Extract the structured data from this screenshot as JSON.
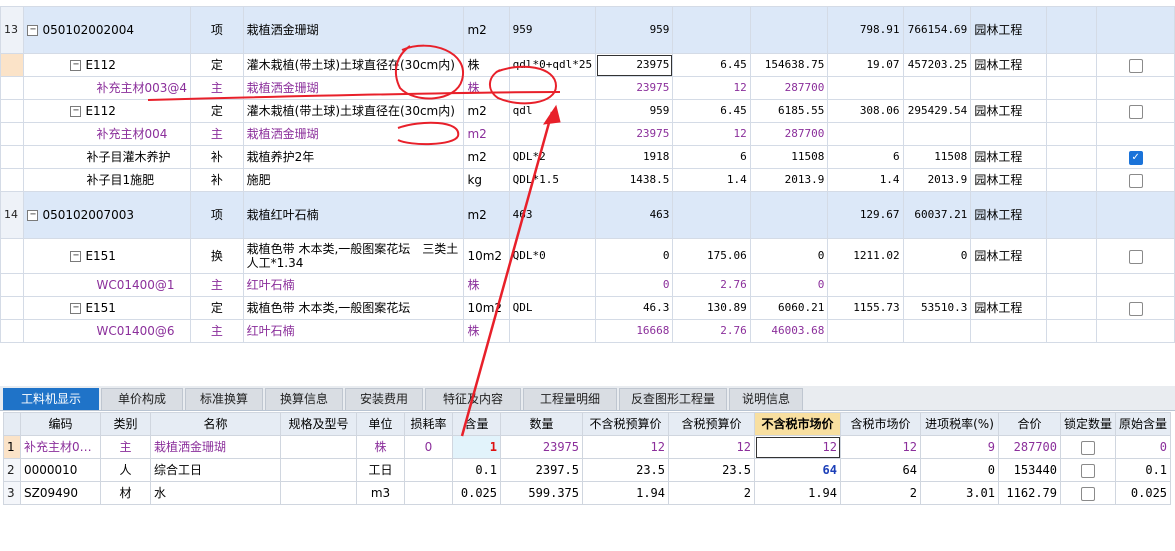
{
  "upper_rows": [
    {
      "rownum": "13",
      "code": "050102002004",
      "type": "项",
      "name": "栽植洒金珊瑚",
      "unit": "m2",
      "expr": "959",
      "qty": "959",
      "price": "",
      "total": "",
      "tax": "798.91",
      "amount": "766154.69",
      "category": "园林工程",
      "checked": null
    },
    {
      "rownum": "",
      "code": "E112",
      "type": "定",
      "name": "灌木栽植(带土球)土球直径在(30cm内)",
      "unit": "株",
      "expr": "qdl*0+qdl*25",
      "qty": "23975",
      "price": "6.45",
      "total": "154638.75",
      "tax": "19.07",
      "amount": "457203.25",
      "category": "园林工程",
      "checked": false
    },
    {
      "rownum": "",
      "code": "补充主材003@4",
      "type": "主",
      "name": "栽植洒金珊瑚",
      "unit": "株",
      "expr": "",
      "qty": "23975",
      "price": "12",
      "total": "287700",
      "tax": "",
      "amount": "",
      "category": "",
      "checked": null
    },
    {
      "rownum": "",
      "code": "E112",
      "type": "定",
      "name": "灌木栽植(带土球)土球直径在(30cm内)",
      "unit": "m2",
      "expr": "qdl",
      "qty": "959",
      "price": "6.45",
      "total": "6185.55",
      "tax": "308.06",
      "amount": "295429.54",
      "category": "园林工程",
      "checked": false
    },
    {
      "rownum": "",
      "code": "补充主材004",
      "type": "主",
      "name": "栽植洒金珊瑚",
      "unit": "m2",
      "expr": "",
      "qty": "23975",
      "price": "12",
      "total": "287700",
      "tax": "",
      "amount": "",
      "category": "",
      "checked": null
    },
    {
      "rownum": "",
      "code": "补子目灌木养护",
      "type": "补",
      "name": "栽植养护2年",
      "unit": "m2",
      "expr": "QDL*2",
      "qty": "1918",
      "price": "6",
      "total": "11508",
      "tax": "6",
      "amount": "11508",
      "category": "园林工程",
      "checked": true
    },
    {
      "rownum": "",
      "code": "补子目1施肥",
      "type": "补",
      "name": "施肥",
      "unit": "kg",
      "expr": "QDL*1.5",
      "qty": "1438.5",
      "price": "1.4",
      "total": "2013.9",
      "tax": "1.4",
      "amount": "2013.9",
      "category": "园林工程",
      "checked": false
    },
    {
      "rownum": "14",
      "code": "050102007003",
      "type": "项",
      "name": "栽植红叶石楠",
      "unit": "m2",
      "expr": "463",
      "qty": "463",
      "price": "",
      "total": "",
      "tax": "129.67",
      "amount": "60037.21",
      "category": "园林工程",
      "checked": null
    },
    {
      "rownum": "",
      "code": "E151",
      "type": "换",
      "name": "栽植色带 木本类,一般图案花坛　三类土人工*1.34",
      "unit": "10m2",
      "expr": "QDL*0",
      "qty": "0",
      "price": "175.06",
      "total": "0",
      "tax": "1211.02",
      "amount": "0",
      "category": "园林工程",
      "checked": false
    },
    {
      "rownum": "",
      "code": "WC01400@1",
      "type": "主",
      "name": "红叶石楠",
      "unit": "株",
      "expr": "",
      "qty": "0",
      "price": "2.76",
      "total": "0",
      "tax": "",
      "amount": "",
      "category": "",
      "checked": null
    },
    {
      "rownum": "",
      "code": "E151",
      "type": "定",
      "name": "栽植色带 木本类,一般图案花坛",
      "unit": "10m2",
      "expr": "QDL",
      "qty": "46.3",
      "price": "130.89",
      "total": "6060.21",
      "tax": "1155.73",
      "amount": "53510.3",
      "category": "园林工程",
      "checked": false
    },
    {
      "rownum": "",
      "code": "WC01400@6",
      "type": "主",
      "name": "红叶石楠",
      "unit": "株",
      "expr": "",
      "qty": "16668",
      "price": "2.76",
      "total": "46003.68",
      "tax": "",
      "amount": "",
      "category": "",
      "checked": null
    }
  ],
  "tabs": [
    "工料机显示",
    "单价构成",
    "标准换算",
    "换算信息",
    "安装费用",
    "特征及内容",
    "工程量明细",
    "反查图形工程量",
    "说明信息"
  ],
  "lower_headers": [
    "",
    "编码",
    "类别",
    "名称",
    "规格及型号",
    "单位",
    "损耗率",
    "含量",
    "数量",
    "不含税预算价",
    "含税预算价",
    "不含税市场价",
    "含税市场价",
    "进项税率(%)",
    "合价",
    "锁定数量",
    "原始含量"
  ],
  "lower_rows": [
    {
      "n": "1",
      "code": "补充主材0…",
      "type": "主",
      "name": "栽植洒金珊瑚",
      "spec": "",
      "unit": "株",
      "loss": "0",
      "content": "1",
      "qty": "23975",
      "p1": "12",
      "p2": "12",
      "p3": "12",
      "p4": "12",
      "rate": "9",
      "total": "287700",
      "orig": "0"
    },
    {
      "n": "2",
      "code": "0000010",
      "type": "人",
      "name": "综合工日",
      "spec": "",
      "unit": "工日",
      "loss": "",
      "content": "0.1",
      "qty": "2397.5",
      "p1": "23.5",
      "p2": "23.5",
      "p3": "64",
      "p4": "64",
      "rate": "0",
      "total": "153440",
      "orig": "0.1"
    },
    {
      "n": "3",
      "code": "SZ09490",
      "type": "材",
      "name": "水",
      "spec": "",
      "unit": "m3",
      "loss": "",
      "content": "0.025",
      "qty": "599.375",
      "p1": "1.94",
      "p2": "2",
      "p3": "1.94",
      "p4": "2",
      "rate": "3.01",
      "total": "1162.79",
      "orig": "0.025"
    }
  ]
}
